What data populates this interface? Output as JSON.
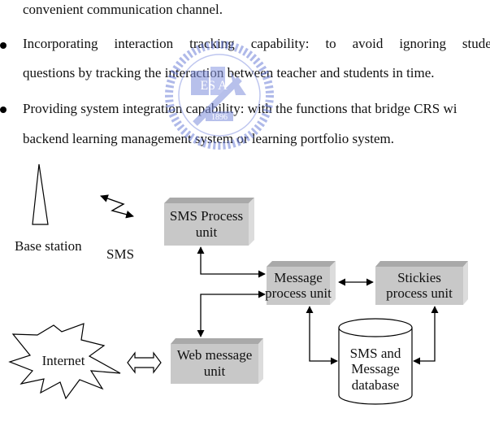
{
  "document": {
    "paragraphs": [
      {
        "type": "continuation",
        "text": "convenient communication channel."
      },
      {
        "type": "bullet",
        "line1": "Incorporating interaction tracking capability: to avoid ignoring student",
        "line2": "questions by tracking the interaction between teacher and students in time."
      },
      {
        "type": "bullet",
        "line1": "Providing system integration capability: with the functions that bridge CRS wi",
        "line2": "backend learning management system or learning portfolio system."
      }
    ],
    "watermark": {
      "label": "1896",
      "letters": "ES A",
      "color": "#5b6fd0"
    }
  },
  "diagram": {
    "colors": {
      "box_fill": "#c8c8c8",
      "box_top": "#a9a9a9",
      "box_side": "#dcdcdc",
      "stroke": "#000000"
    },
    "labels": {
      "base_station": "Base station",
      "sms": "SMS",
      "internet": "Internet"
    },
    "boxes": {
      "sms_process": {
        "line1": "SMS Process",
        "line2": "unit"
      },
      "message_process": {
        "line1": "Message",
        "line2": "process unit"
      },
      "stickies_process": {
        "line1": "Stickies",
        "line2": "process unit"
      },
      "web_message": {
        "line1": "Web message",
        "line2": "unit"
      }
    },
    "database": {
      "line1": "SMS and",
      "line2": "Message",
      "line3": "database"
    }
  }
}
